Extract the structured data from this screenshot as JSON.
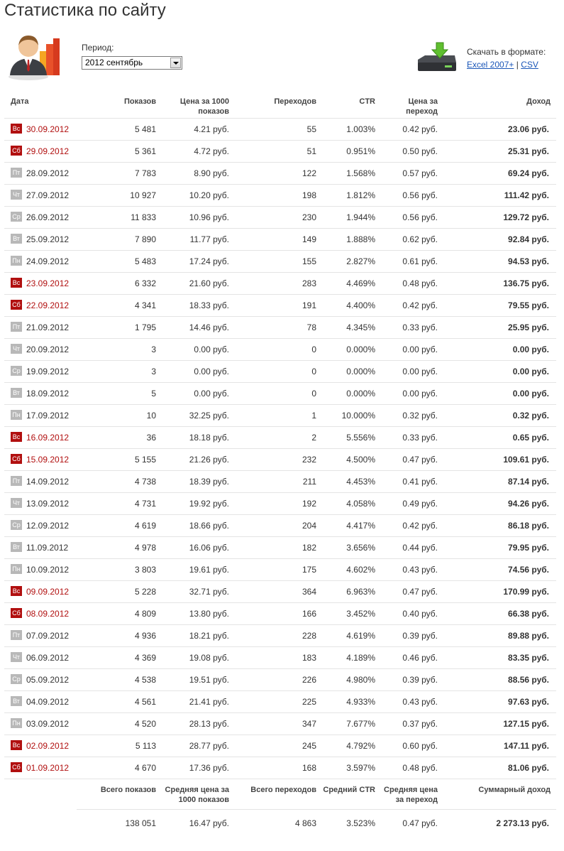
{
  "page": {
    "title": "Статистика по сайту"
  },
  "period": {
    "label": "Период:",
    "selected": "2012 сентябрь"
  },
  "download": {
    "label": "Скачать в формате:",
    "excel": "Excel 2007+",
    "separator": "|",
    "csv": "CSV"
  },
  "colors": {
    "weekend": "#b10f0f",
    "weekday_badge": "#b8b8b8",
    "link": "#1a56b8"
  },
  "icons": {
    "user": "user-chart-icon",
    "drive": "download-drive-icon"
  },
  "table": {
    "headers": {
      "date": "Дата",
      "views": "Показов",
      "cpm": "Цена за 1000 показов",
      "clicks": "Переходов",
      "ctr": "CTR",
      "cpc": "Цена за переход",
      "income": "Доход"
    },
    "rows": [
      {
        "day": "Вс",
        "weekend": true,
        "date": "30.09.2012",
        "views": "5 481",
        "cpm": "4.21 руб.",
        "clicks": "55",
        "ctr": "1.003%",
        "cpc": "0.42 руб.",
        "income": "23.06 руб."
      },
      {
        "day": "Сб",
        "weekend": true,
        "date": "29.09.2012",
        "views": "5 361",
        "cpm": "4.72 руб.",
        "clicks": "51",
        "ctr": "0.951%",
        "cpc": "0.50 руб.",
        "income": "25.31 руб."
      },
      {
        "day": "Пт",
        "weekend": false,
        "date": "28.09.2012",
        "views": "7 783",
        "cpm": "8.90 руб.",
        "clicks": "122",
        "ctr": "1.568%",
        "cpc": "0.57 руб.",
        "income": "69.24 руб."
      },
      {
        "day": "Чт",
        "weekend": false,
        "date": "27.09.2012",
        "views": "10 927",
        "cpm": "10.20 руб.",
        "clicks": "198",
        "ctr": "1.812%",
        "cpc": "0.56 руб.",
        "income": "111.42 руб."
      },
      {
        "day": "Ср",
        "weekend": false,
        "date": "26.09.2012",
        "views": "11 833",
        "cpm": "10.96 руб.",
        "clicks": "230",
        "ctr": "1.944%",
        "cpc": "0.56 руб.",
        "income": "129.72 руб."
      },
      {
        "day": "Вт",
        "weekend": false,
        "date": "25.09.2012",
        "views": "7 890",
        "cpm": "11.77 руб.",
        "clicks": "149",
        "ctr": "1.888%",
        "cpc": "0.62 руб.",
        "income": "92.84 руб."
      },
      {
        "day": "Пн",
        "weekend": false,
        "date": "24.09.2012",
        "views": "5 483",
        "cpm": "17.24 руб.",
        "clicks": "155",
        "ctr": "2.827%",
        "cpc": "0.61 руб.",
        "income": "94.53 руб."
      },
      {
        "day": "Вс",
        "weekend": true,
        "date": "23.09.2012",
        "views": "6 332",
        "cpm": "21.60 руб.",
        "clicks": "283",
        "ctr": "4.469%",
        "cpc": "0.48 руб.",
        "income": "136.75 руб."
      },
      {
        "day": "Сб",
        "weekend": true,
        "date": "22.09.2012",
        "views": "4 341",
        "cpm": "18.33 руб.",
        "clicks": "191",
        "ctr": "4.400%",
        "cpc": "0.42 руб.",
        "income": "79.55 руб."
      },
      {
        "day": "Пт",
        "weekend": false,
        "date": "21.09.2012",
        "views": "1 795",
        "cpm": "14.46 руб.",
        "clicks": "78",
        "ctr": "4.345%",
        "cpc": "0.33 руб.",
        "income": "25.95 руб."
      },
      {
        "day": "Чт",
        "weekend": false,
        "date": "20.09.2012",
        "views": "3",
        "cpm": "0.00 руб.",
        "clicks": "0",
        "ctr": "0.000%",
        "cpc": "0.00 руб.",
        "income": "0.00 руб."
      },
      {
        "day": "Ср",
        "weekend": false,
        "date": "19.09.2012",
        "views": "3",
        "cpm": "0.00 руб.",
        "clicks": "0",
        "ctr": "0.000%",
        "cpc": "0.00 руб.",
        "income": "0.00 руб."
      },
      {
        "day": "Вт",
        "weekend": false,
        "date": "18.09.2012",
        "views": "5",
        "cpm": "0.00 руб.",
        "clicks": "0",
        "ctr": "0.000%",
        "cpc": "0.00 руб.",
        "income": "0.00 руб."
      },
      {
        "day": "Пн",
        "weekend": false,
        "date": "17.09.2012",
        "views": "10",
        "cpm": "32.25 руб.",
        "clicks": "1",
        "ctr": "10.000%",
        "cpc": "0.32 руб.",
        "income": "0.32 руб."
      },
      {
        "day": "Вс",
        "weekend": true,
        "date": "16.09.2012",
        "views": "36",
        "cpm": "18.18 руб.",
        "clicks": "2",
        "ctr": "5.556%",
        "cpc": "0.33 руб.",
        "income": "0.65 руб."
      },
      {
        "day": "Сб",
        "weekend": true,
        "date": "15.09.2012",
        "views": "5 155",
        "cpm": "21.26 руб.",
        "clicks": "232",
        "ctr": "4.500%",
        "cpc": "0.47 руб.",
        "income": "109.61 руб."
      },
      {
        "day": "Пт",
        "weekend": false,
        "date": "14.09.2012",
        "views": "4 738",
        "cpm": "18.39 руб.",
        "clicks": "211",
        "ctr": "4.453%",
        "cpc": "0.41 руб.",
        "income": "87.14 руб."
      },
      {
        "day": "Чт",
        "weekend": false,
        "date": "13.09.2012",
        "views": "4 731",
        "cpm": "19.92 руб.",
        "clicks": "192",
        "ctr": "4.058%",
        "cpc": "0.49 руб.",
        "income": "94.26 руб."
      },
      {
        "day": "Ср",
        "weekend": false,
        "date": "12.09.2012",
        "views": "4 619",
        "cpm": "18.66 руб.",
        "clicks": "204",
        "ctr": "4.417%",
        "cpc": "0.42 руб.",
        "income": "86.18 руб."
      },
      {
        "day": "Вт",
        "weekend": false,
        "date": "11.09.2012",
        "views": "4 978",
        "cpm": "16.06 руб.",
        "clicks": "182",
        "ctr": "3.656%",
        "cpc": "0.44 руб.",
        "income": "79.95 руб."
      },
      {
        "day": "Пн",
        "weekend": false,
        "date": "10.09.2012",
        "views": "3 803",
        "cpm": "19.61 руб.",
        "clicks": "175",
        "ctr": "4.602%",
        "cpc": "0.43 руб.",
        "income": "74.56 руб."
      },
      {
        "day": "Вс",
        "weekend": true,
        "date": "09.09.2012",
        "views": "5 228",
        "cpm": "32.71 руб.",
        "clicks": "364",
        "ctr": "6.963%",
        "cpc": "0.47 руб.",
        "income": "170.99 руб."
      },
      {
        "day": "Сб",
        "weekend": true,
        "date": "08.09.2012",
        "views": "4 809",
        "cpm": "13.80 руб.",
        "clicks": "166",
        "ctr": "3.452%",
        "cpc": "0.40 руб.",
        "income": "66.38 руб."
      },
      {
        "day": "Пт",
        "weekend": false,
        "date": "07.09.2012",
        "views": "4 936",
        "cpm": "18.21 руб.",
        "clicks": "228",
        "ctr": "4.619%",
        "cpc": "0.39 руб.",
        "income": "89.88 руб."
      },
      {
        "day": "Чт",
        "weekend": false,
        "date": "06.09.2012",
        "views": "4 369",
        "cpm": "19.08 руб.",
        "clicks": "183",
        "ctr": "4.189%",
        "cpc": "0.46 руб.",
        "income": "83.35 руб."
      },
      {
        "day": "Ср",
        "weekend": false,
        "date": "05.09.2012",
        "views": "4 538",
        "cpm": "19.51 руб.",
        "clicks": "226",
        "ctr": "4.980%",
        "cpc": "0.39 руб.",
        "income": "88.56 руб."
      },
      {
        "day": "Вт",
        "weekend": false,
        "date": "04.09.2012",
        "views": "4 561",
        "cpm": "21.41 руб.",
        "clicks": "225",
        "ctr": "4.933%",
        "cpc": "0.43 руб.",
        "income": "97.63 руб."
      },
      {
        "day": "Пн",
        "weekend": false,
        "date": "03.09.2012",
        "views": "4 520",
        "cpm": "28.13 руб.",
        "clicks": "347",
        "ctr": "7.677%",
        "cpc": "0.37 руб.",
        "income": "127.15 руб."
      },
      {
        "day": "Вс",
        "weekend": true,
        "date": "02.09.2012",
        "views": "5 113",
        "cpm": "28.77 руб.",
        "clicks": "245",
        "ctr": "4.792%",
        "cpc": "0.60 руб.",
        "income": "147.11 руб."
      },
      {
        "day": "Сб",
        "weekend": true,
        "date": "01.09.2012",
        "views": "4 670",
        "cpm": "17.36 руб.",
        "clicks": "168",
        "ctr": "3.597%",
        "cpc": "0.48 руб.",
        "income": "81.06 руб."
      }
    ],
    "totals_headers": {
      "views": "Всего показов",
      "cpm": "Средняя цена за 1000 показов",
      "clicks": "Всего переходов",
      "ctr": "Средний CTR",
      "cpc": "Средняя цена за переход",
      "income": "Суммарный доход"
    },
    "totals": {
      "views": "138 051",
      "cpm": "16.47 руб.",
      "clicks": "4 863",
      "ctr": "3.523%",
      "cpc": "0.47 руб.",
      "income": "2 273.13 руб."
    }
  }
}
